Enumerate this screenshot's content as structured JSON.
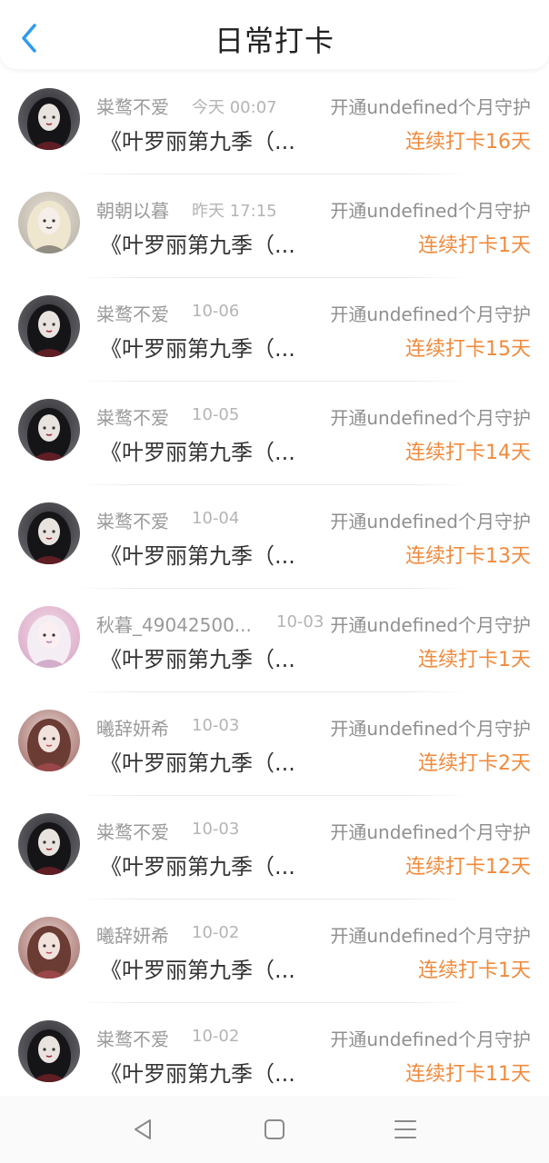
{
  "header": {
    "title": "日常打卡"
  },
  "colors": {
    "accent": "#2f9bf0",
    "streak": "#f08a3c"
  },
  "list": [
    {
      "name": "粜鹜不爱",
      "time": "今天 00:07",
      "guard": "开通undefined个月守护",
      "book": "《叶罗丽第九季（...",
      "streak": "连续打卡16天",
      "avatar": "dark-avatar"
    },
    {
      "name": "朝朝以暮",
      "time": "昨天 17:15",
      "guard": "开通undefined个月守护",
      "book": "《叶罗丽第九季（...",
      "streak": "连续打卡1天",
      "avatar": "light-avatar"
    },
    {
      "name": "粜鹜不爱",
      "time": "10-06",
      "guard": "开通undefined个月守护",
      "book": "《叶罗丽第九季（...",
      "streak": "连续打卡15天",
      "avatar": "dark-avatar"
    },
    {
      "name": "粜鹜不爱",
      "time": "10-05",
      "guard": "开通undefined个月守护",
      "book": "《叶罗丽第九季（...",
      "streak": "连续打卡14天",
      "avatar": "dark-avatar"
    },
    {
      "name": "粜鹜不爱",
      "time": "10-04",
      "guard": "开通undefined个月守护",
      "book": "《叶罗丽第九季（...",
      "streak": "连续打卡13天",
      "avatar": "dark-avatar"
    },
    {
      "name": "秋暮_49042500...",
      "time": "10-03",
      "guard": "开通undefined个月守护",
      "book": "《叶罗丽第九季（...",
      "streak": "连续打卡1天",
      "avatar": "pink-avatar"
    },
    {
      "name": "曦辞妍希",
      "time": "10-03",
      "guard": "开通undefined个月守护",
      "book": "《叶罗丽第九季（...",
      "streak": "连续打卡2天",
      "avatar": "rose-avatar"
    },
    {
      "name": "粜鹜不爱",
      "time": "10-03",
      "guard": "开通undefined个月守护",
      "book": "《叶罗丽第九季（...",
      "streak": "连续打卡12天",
      "avatar": "dark-avatar"
    },
    {
      "name": "曦辞妍希",
      "time": "10-02",
      "guard": "开通undefined个月守护",
      "book": "《叶罗丽第九季（...",
      "streak": "连续打卡1天",
      "avatar": "rose-avatar"
    },
    {
      "name": "粜鹜不爱",
      "time": "10-02",
      "guard": "开通undefined个月守护",
      "book": "《叶罗丽第九季（...",
      "streak": "连续打卡11天",
      "avatar": "dark-avatar"
    }
  ],
  "navbar": {
    "items": [
      "back-triangle-icon",
      "home-square-icon",
      "menu-lines-icon"
    ]
  }
}
